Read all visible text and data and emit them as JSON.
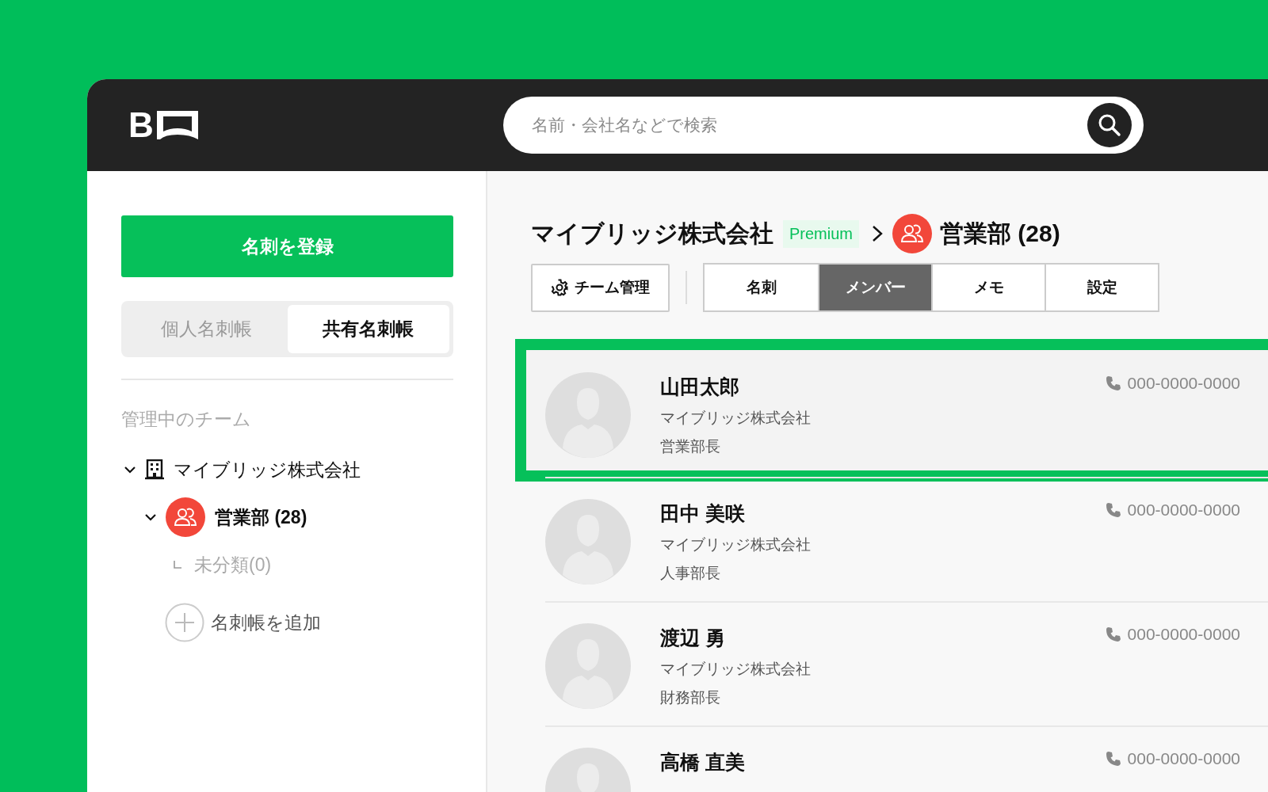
{
  "header": {
    "logo_text": "B",
    "search": {
      "placeholder": "名前・会社名などで検索"
    }
  },
  "sidebar": {
    "register_button": "名刺を登録",
    "book_tabs": [
      {
        "label": "個人名刺帳",
        "selected": false
      },
      {
        "label": "共有名刺帳",
        "selected": true
      }
    ],
    "section_label": "管理中のチーム",
    "tree": [
      {
        "kind": "company",
        "label": "マイブリッジ株式会社",
        "expanded": true,
        "children": [
          {
            "kind": "team",
            "label": "営業部 (28)",
            "expanded": true,
            "children": [
              {
                "kind": "uncategorized",
                "label": "未分類(0)"
              }
            ]
          }
        ]
      }
    ],
    "add_label": "名刺帳を追加"
  },
  "main": {
    "breadcrumb": {
      "company": "マイブリッジ株式会社",
      "badge": "Premium",
      "team": "営業部 (28)"
    },
    "manage_button": "チーム管理",
    "tabs": [
      {
        "label": "名刺",
        "selected": false
      },
      {
        "label": "メンバー",
        "selected": true
      },
      {
        "label": "メモ",
        "selected": false
      },
      {
        "label": "設定",
        "selected": false
      }
    ],
    "members": [
      {
        "name": "山田太郎",
        "company": "マイブリッジ株式会社",
        "title": "営業部長",
        "phone": "000-0000-0000",
        "selected": true
      },
      {
        "name": "田中 美咲",
        "company": "マイブリッジ株式会社",
        "title": "人事部長",
        "phone": "000-0000-0000",
        "selected": false
      },
      {
        "name": "渡辺 勇",
        "company": "マイブリッジ株式会社",
        "title": "財務部長",
        "phone": "000-0000-0000",
        "selected": false
      },
      {
        "name": "高橋 直美",
        "phone": "000-0000-0000",
        "selected": false
      }
    ]
  }
}
